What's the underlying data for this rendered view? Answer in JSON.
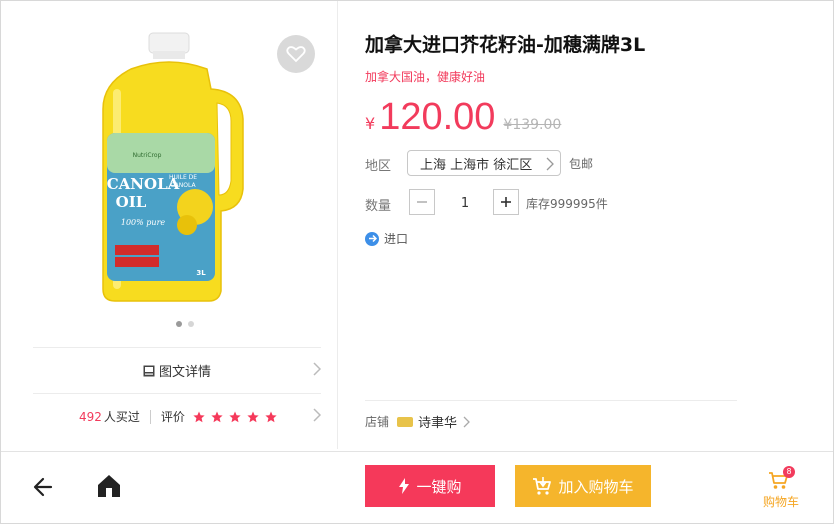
{
  "product": {
    "title": "加拿大进口芥花籽油-加穗满牌3L",
    "subtitle": "加拿大国油，健康好油",
    "currency": "¥",
    "price": "120.00",
    "old_price": "¥139.00",
    "image_label": {
      "brand": "NutriCrop",
      "line1": "CANOLA",
      "line2": "OIL",
      "sub1": "HUILE DE",
      "sub2": "CANOLA",
      "pure": "100% pure",
      "size": "3L"
    }
  },
  "gallery": {
    "count": 2,
    "active_index": 0
  },
  "region": {
    "label": "地区",
    "value": "上海 上海市 徐汇区",
    "shipping": "包邮"
  },
  "quantity": {
    "label": "数量",
    "value": "1",
    "stock": "库存999995件"
  },
  "tag": {
    "text": "进口"
  },
  "detail": {
    "label": "图文详情"
  },
  "reviews": {
    "count": "492",
    "bought_label": "人买过",
    "rating_label": "评价",
    "rating": 5,
    "max_rating": 5
  },
  "shop": {
    "label": "店铺",
    "name": "诗聿华"
  },
  "bottom_bar": {
    "buy_now": "一键购",
    "add_to_cart": "加入购物车",
    "cart_label": "购物车",
    "cart_count": "8"
  },
  "colors": {
    "accent_red": "#f5395a",
    "accent_orange": "#f5b52c",
    "tag_blue": "#3d8fe8"
  }
}
